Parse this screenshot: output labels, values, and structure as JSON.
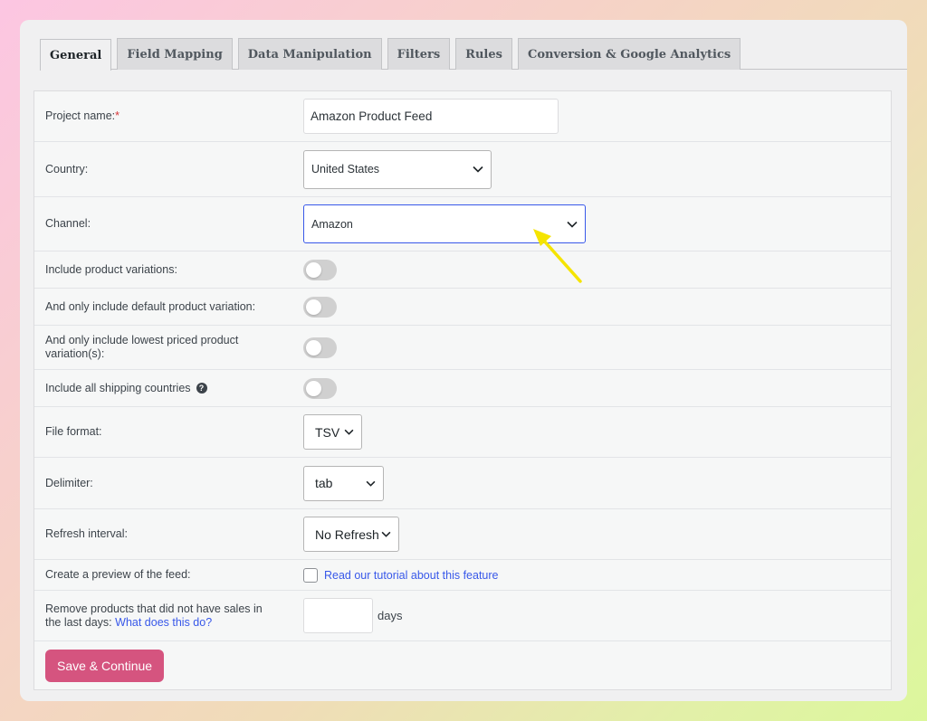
{
  "tabs": [
    "General",
    "Field Mapping",
    "Data Manipulation",
    "Filters",
    "Rules",
    "Conversion & Google Analytics"
  ],
  "form": {
    "project_name": {
      "label": "Project name:",
      "required_mark": "*",
      "value": "Amazon Product Feed"
    },
    "country": {
      "label": "Country:",
      "value": "United States"
    },
    "channel": {
      "label": "Channel:",
      "value": "Amazon"
    },
    "product_variations": {
      "label": "Include product variations:"
    },
    "default_variation": {
      "label": "And only include default product variation:"
    },
    "lowest_priced": {
      "label": "And only include lowest priced product variation(s):"
    },
    "shipping_countries": {
      "label": "Include all shipping countries",
      "help_icon": "?"
    },
    "file_format": {
      "label": "File format:",
      "value": "TSV"
    },
    "delimiter": {
      "label": "Delimiter:",
      "value": "tab"
    },
    "refresh_interval": {
      "label": "Refresh interval:",
      "value": "No Refresh"
    },
    "preview": {
      "label": "Create a preview of the feed:",
      "link": "Read our tutorial about this feature"
    },
    "remove_products": {
      "label": "Remove products that did not have sales in the last days:",
      "link": "What does this do?",
      "value": "",
      "suffix": "days"
    }
  },
  "buttons": {
    "save": "Save & Continue"
  },
  "colors": {
    "accent": "#3858e9",
    "button": "#d5547f",
    "annotation_arrow": "#f5e400"
  },
  "icons": {
    "dropdown": "chevron-down-icon",
    "help": "help-circle-icon",
    "annotation": "arrow-icon"
  }
}
